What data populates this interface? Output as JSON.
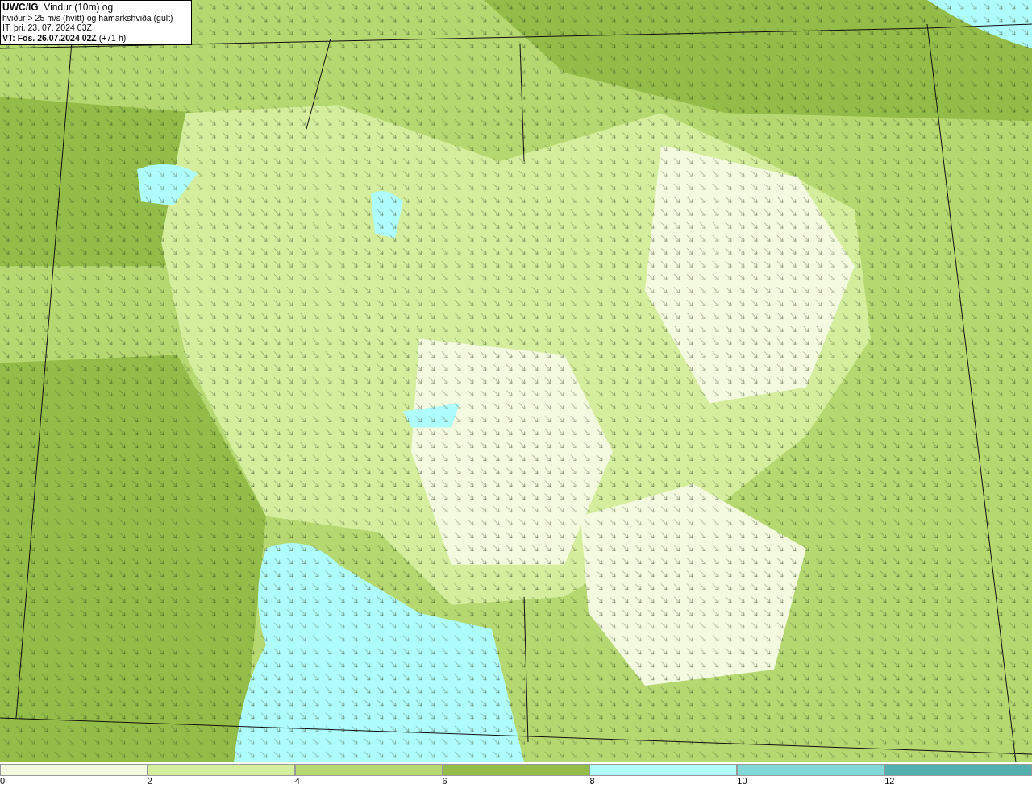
{
  "title_box": {
    "lines": [
      "**UWC/IG**: Vindur (10m) og",
      "hviður > 25 m/s (hvítt) og hámarkshviða (gult)",
      "IT: þri. 23. 07. 2024 03Z",
      "**VT: Fös. 26.07.2024 02Z** (+71 h)"
    ]
  },
  "legend": {
    "bins": [
      {
        "color": "#f3fadf",
        "label": "0"
      },
      {
        "color": "#d5ee9d",
        "label": "2"
      },
      {
        "color": "#b5d870",
        "label": "4"
      },
      {
        "color": "#93bd48",
        "label": "6"
      },
      {
        "color": "#aefcfc",
        "label": "8"
      },
      {
        "color": "#80d8d8",
        "label": "10"
      },
      {
        "color": "#52b0b0",
        "label": "12"
      }
    ]
  }
}
